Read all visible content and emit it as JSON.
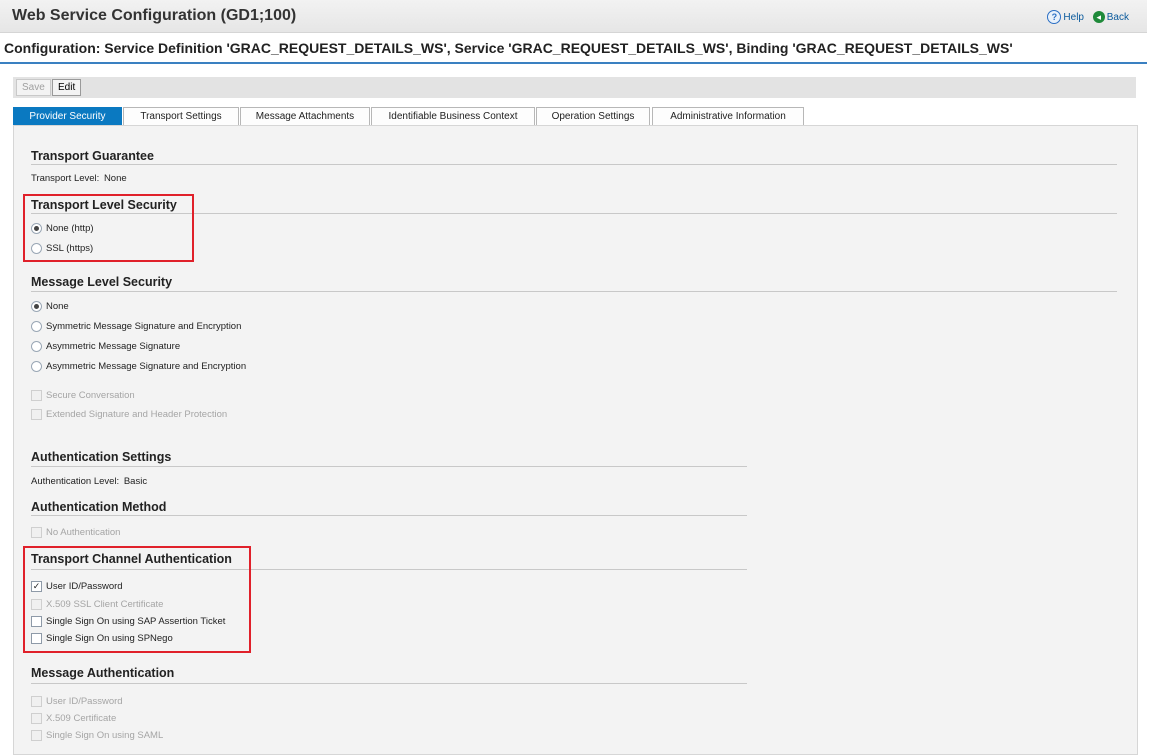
{
  "header": {
    "app_title": "Web Service Configuration (GD1;100)",
    "help_label": "Help",
    "back_label": "Back"
  },
  "page_title": "Configuration: Service Definition 'GRAC_REQUEST_DETAILS_WS', Service 'GRAC_REQUEST_DETAILS_WS', Binding 'GRAC_REQUEST_DETAILS_WS'",
  "toolbar": {
    "save_label": "Save",
    "edit_label": "Edit"
  },
  "tabs": [
    {
      "label": "Provider Security",
      "active": true
    },
    {
      "label": "Transport Settings"
    },
    {
      "label": "Message Attachments"
    },
    {
      "label": "Identifiable Business Context"
    },
    {
      "label": "Operation Settings"
    },
    {
      "label": "Administrative Information"
    }
  ],
  "transport_guarantee": {
    "title": "Transport Guarantee",
    "level_label": "Transport Level:",
    "level_value": "None"
  },
  "transport_level_security": {
    "title": "Transport Level Security",
    "options": [
      {
        "label": "None (http)",
        "selected": true
      },
      {
        "label": "SSL (https)",
        "selected": false
      }
    ]
  },
  "message_level_security": {
    "title": "Message Level Security",
    "options": [
      {
        "label": "None",
        "selected": true
      },
      {
        "label": "Symmetric Message Signature and Encryption"
      },
      {
        "label": "Asymmetric Message Signature"
      },
      {
        "label": "Asymmetric Message Signature and Encryption"
      }
    ],
    "checkboxes": [
      {
        "label": "Secure Conversation",
        "disabled": true
      },
      {
        "label": "Extended Signature and Header Protection",
        "disabled": true
      }
    ]
  },
  "authentication_settings": {
    "title": "Authentication Settings",
    "level_label": "Authentication Level:",
    "level_value": "Basic"
  },
  "authentication_method": {
    "title": "Authentication Method",
    "checkboxes": [
      {
        "label": "No Authentication",
        "disabled": true
      }
    ]
  },
  "transport_channel_authentication": {
    "title": "Transport Channel Authentication",
    "checkboxes": [
      {
        "label": "User ID/Password",
        "checked": true,
        "check_mark": "✓"
      },
      {
        "label": "X.509 SSL Client Certificate",
        "disabled": true
      },
      {
        "label": "Single Sign On using SAP Assertion Ticket"
      },
      {
        "label": "Single Sign On using SPNego"
      }
    ]
  },
  "message_authentication": {
    "title": "Message Authentication",
    "checkboxes": [
      {
        "label": "User ID/Password",
        "disabled": true
      },
      {
        "label": "X.509 Certificate",
        "disabled": true
      },
      {
        "label": "Single Sign On using SAML",
        "disabled": true
      }
    ]
  },
  "colors": {
    "accent": "#0a79c1",
    "highlight": "#e0202a",
    "title_rule": "#3a80c1"
  }
}
